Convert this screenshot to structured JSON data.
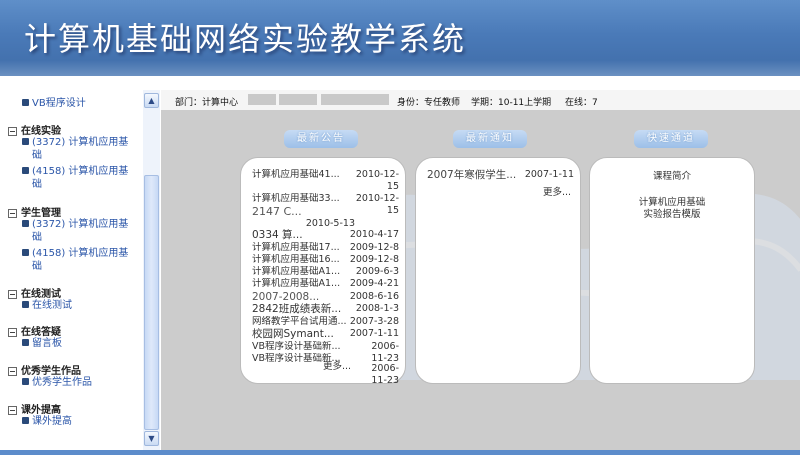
{
  "header": {
    "title": "计算机基础网络实验教学系统"
  },
  "sidebar": {
    "top_item": "VB程序设计",
    "sections": [
      {
        "title": "在线实验",
        "items": [
          "(3372) 计算机应用基础",
          "(4158) 计算机应用基础"
        ]
      },
      {
        "title": "学生管理",
        "items": [
          "(3372) 计算机应用基础",
          "(4158) 计算机应用基础"
        ]
      },
      {
        "title": "在线测试",
        "items": [
          "在线测试"
        ]
      },
      {
        "title": "在线答疑",
        "items": [
          "留言板"
        ]
      },
      {
        "title": "优秀学生作品",
        "items": [
          "优秀学生作品"
        ]
      },
      {
        "title": "课外提高",
        "items": [
          "课外提高"
        ]
      }
    ],
    "scroll_up": "▲",
    "scroll_down": "▼"
  },
  "infobar": {
    "dept": "部门：计算中心",
    "identity": "身份：专任教师",
    "term": "学期：10-11上学期",
    "online": "在线：7"
  },
  "announcements": {
    "label": "最新公告",
    "rows": [
      {
        "title": "计算机应用基础41...",
        "date": "2010-12-15"
      },
      {
        "title": "计算机应用基础33...",
        "date": "2010-12-15"
      },
      {
        "title": "2147 C...",
        "date": "2010-5-13"
      },
      {
        "title": "0334 算...",
        "date": "2010-4-17"
      },
      {
        "title": "计算机应用基础17...",
        "date": "2009-12-8"
      },
      {
        "title": "计算机应用基础16...",
        "date": "2009-12-8"
      },
      {
        "title": "计算机应用基础A1...",
        "date": "2009-6-3"
      },
      {
        "title": "计算机应用基础A1...",
        "date": "2009-4-21"
      },
      {
        "title": "2007-2008...",
        "date": "2008-6-16"
      },
      {
        "title": "2842班成绩表新...",
        "date": "2008-1-3"
      },
      {
        "title": "网络教学平台试用通...",
        "date": "2007-3-28"
      },
      {
        "title": "校园网Symant...",
        "date": "2007-1-11"
      },
      {
        "title": "VB程序设计基础新...",
        "date": "2006-11-23"
      },
      {
        "title": "VB程序设计基础新...",
        "date": "2006-11-23"
      }
    ],
    "more": "更多..."
  },
  "notices": {
    "label": "最新通知",
    "rows": [
      {
        "title": "2007年寒假学生...",
        "date": "2007-1-11"
      }
    ],
    "more": "更多..."
  },
  "quick": {
    "label": "快速通道",
    "items": [
      "课程简介",
      "计算机应用基础",
      "实验报告模版"
    ]
  }
}
